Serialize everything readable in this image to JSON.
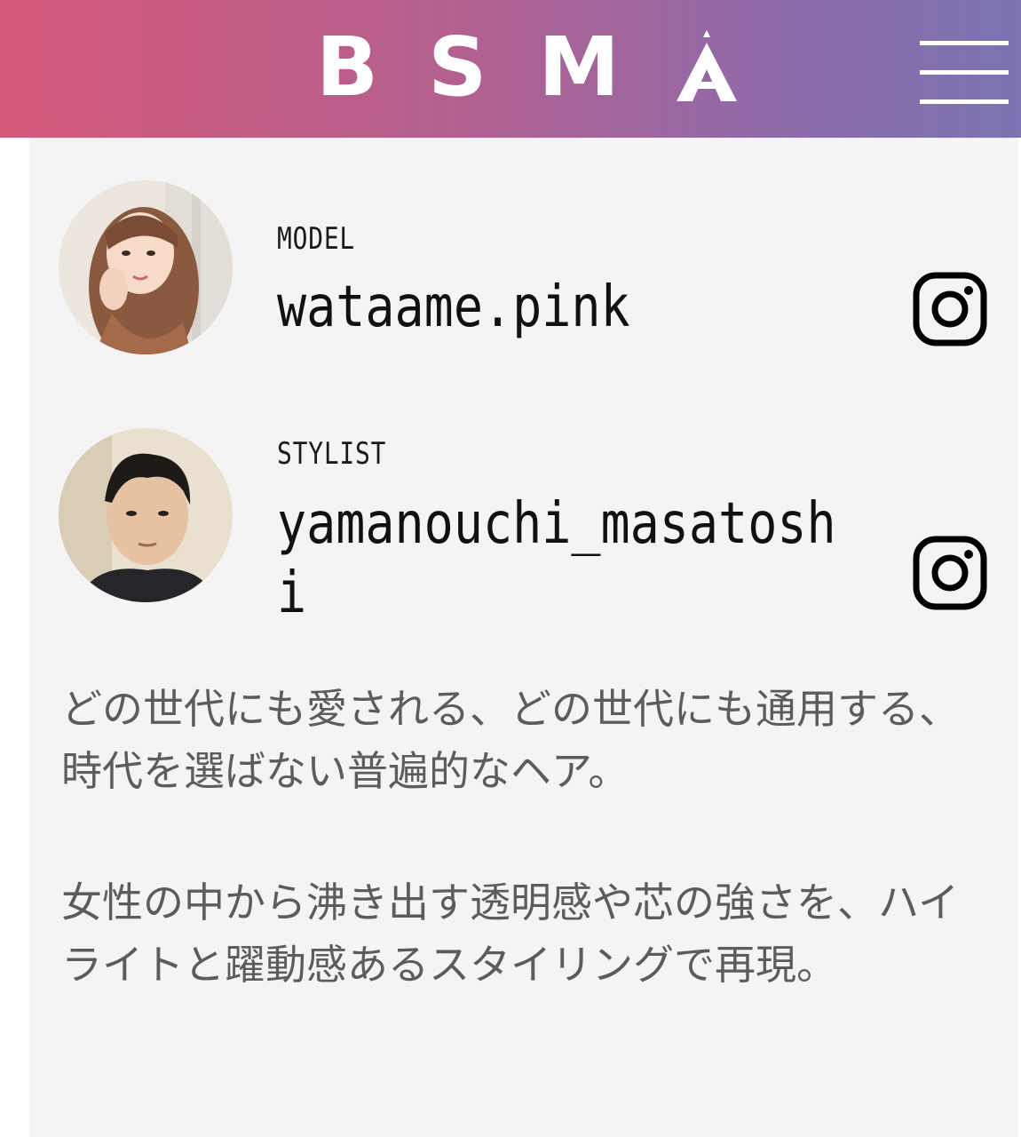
{
  "header": {
    "logo_letters": [
      "B",
      "S",
      "M"
    ],
    "logo_last_letter": "A",
    "menu_icon": "hamburger-menu-icon",
    "gradient_colors": [
      "#d65a7a",
      "#7b73b3"
    ]
  },
  "credits": [
    {
      "role": "MODEL",
      "handle": "wataame.pink",
      "icon": "instagram-icon"
    },
    {
      "role": "STYLIST",
      "handle": "yamanouchi_masatoshi",
      "icon": "instagram-icon"
    }
  ],
  "description": [
    "どの世代にも愛される、どの世代にも通用する、時代を選ばない普遍的なヘア。",
    "女性の中から沸き出す透明感や芯の強さを、ハイライトと躍動感あるスタイリングで再現。"
  ],
  "colors": {
    "content_bg": "#f4f4f4",
    "description_text": "#5c5c5c"
  }
}
